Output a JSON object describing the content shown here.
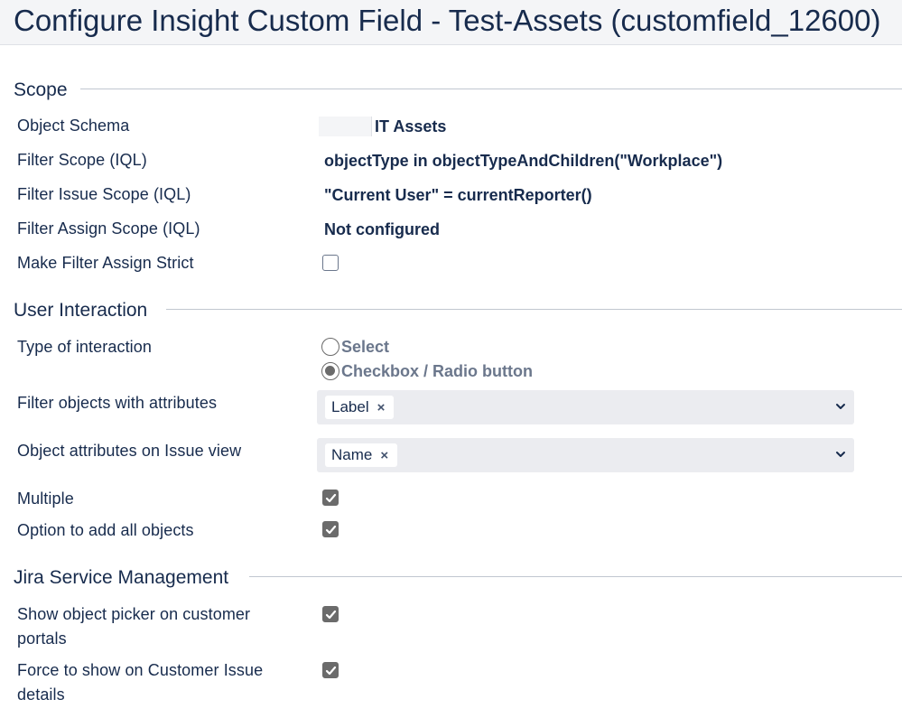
{
  "page": {
    "title": "Configure Insight Custom Field - Test-Assets (customfield_12600)"
  },
  "scope": {
    "heading": "Scope",
    "object_schema_label": "Object Schema",
    "object_schema_value": "IT Assets",
    "filter_scope_label": "Filter Scope (IQL)",
    "filter_scope_value": "objectType in objectTypeAndChildren(\"Workplace\")",
    "filter_issue_scope_label": "Filter Issue Scope (IQL)",
    "filter_issue_scope_value": "\"Current User\" = currentReporter()",
    "filter_assign_scope_label": "Filter Assign Scope (IQL)",
    "filter_assign_scope_value": "Not configured",
    "make_filter_assign_strict_label": "Make Filter Assign Strict",
    "make_filter_assign_strict_checked": false
  },
  "user_interaction": {
    "heading": "User Interaction",
    "type_of_interaction_label": "Type of interaction",
    "options": [
      {
        "label": "Select",
        "selected": false
      },
      {
        "label": "Checkbox / Radio button",
        "selected": true
      }
    ],
    "filter_objects_label": "Filter objects with attributes",
    "filter_objects_tag": "Label",
    "issue_view_attrs_label": "Object attributes on Issue view",
    "issue_view_attrs_tag": "Name",
    "tag_remove_glyph": "×",
    "multiple_label": "Multiple",
    "multiple_checked": true,
    "add_all_label": "Option to add all objects",
    "add_all_checked": true
  },
  "jsm": {
    "heading": "Jira Service Management",
    "show_picker_label": "Show object picker on customer portals",
    "show_picker_checked": true,
    "force_show_label": "Force to show on Customer Issue details",
    "force_show_checked": true
  },
  "colors": {
    "text": "#172b4d",
    "muted": "#6b778c",
    "header_bg": "#f4f5f7",
    "select_bg": "#ebecf0",
    "checkbox_fill": "#6b6b6b"
  }
}
